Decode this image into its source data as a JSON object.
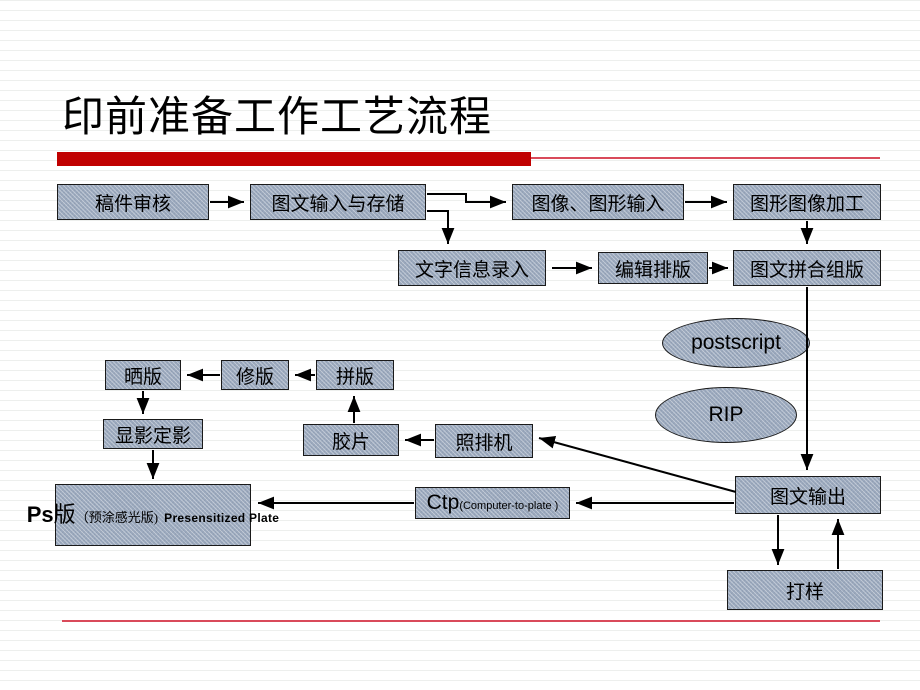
{
  "slide": {
    "title": "印前准备工作工艺流程",
    "accent_color": "#c00000",
    "rule_thin_color": "#d94a5a",
    "node_fill_color": "#9aa8bd",
    "node_border_color": "#1a1a1a",
    "background_color": "#ffffff"
  },
  "nodes": {
    "manuscript_review": "稿件审核",
    "text_image_input_storage": "图文输入与存储",
    "image_graphic_input": "图像、图形输入",
    "graphic_image_processing": "图形图像加工",
    "text_information_entry": "文字信息录入",
    "edit_typesetting": "编辑排版",
    "text_image_assembly": "图文拼合组版",
    "postscript": "postscript",
    "rip": "RIP",
    "plate_exposure": "晒版",
    "plate_retouch": "修版",
    "imposition": "拼版",
    "develop_fix": "显影定影",
    "film_left": "胶片",
    "film_right": "胶片",
    "imagesetter": "照排机",
    "text_image_output": "图文输出",
    "proofing": "打样",
    "ps_plate": {
      "abbr": "Ps",
      "abbr_cn": "版",
      "paren_cn": "（预涂感光版)",
      "english": "Presensitized Plate"
    },
    "ctp": {
      "abbr": "Ctp",
      "expansion": "(Computer-to-plate )"
    }
  },
  "flow_edges": [
    {
      "from": "稿件审核",
      "to": "图文输入与存储"
    },
    {
      "from": "图文输入与存储",
      "to": "图像、图形输入"
    },
    {
      "from": "图文输入与存储",
      "to": "文字信息录入"
    },
    {
      "from": "图像、图形输入",
      "to": "图形图像加工"
    },
    {
      "from": "图形图像加工",
      "to": "图文拼合组版"
    },
    {
      "from": "文字信息录入",
      "to": "编辑排版"
    },
    {
      "from": "编辑排版",
      "to": "图文拼合组版"
    },
    {
      "from": "图文拼合组版",
      "to": "图文输出"
    },
    {
      "from": "图文输出",
      "to": "照排机"
    },
    {
      "from": "图文输出",
      "to": "Ctp"
    },
    {
      "from": "图文输出",
      "to": "打样"
    },
    {
      "from": "打样",
      "to": "图文输出"
    },
    {
      "from": "照排机",
      "to": "胶片"
    },
    {
      "from": "胶片",
      "to": "拼版"
    },
    {
      "from": "拼版",
      "to": "修版"
    },
    {
      "from": "修版",
      "to": "晒版"
    },
    {
      "from": "晒版",
      "to": "显影定影"
    },
    {
      "from": "显影定影",
      "to": "Ps版"
    },
    {
      "from": "Ctp",
      "to": "Ps版"
    }
  ]
}
